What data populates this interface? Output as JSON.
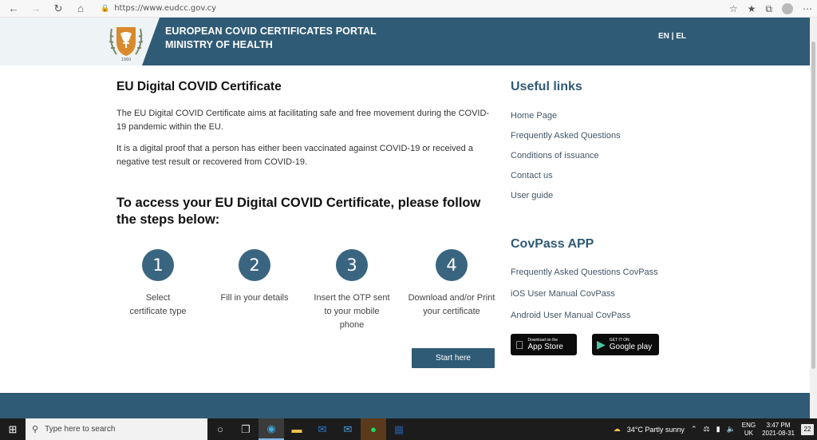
{
  "browser": {
    "url": "https://www.eudcc.gov.cy",
    "back_icon": "arrow-left-icon",
    "forward_icon": "arrow-right-icon",
    "reload_icon": "reload-icon",
    "home_icon": "home-icon"
  },
  "header": {
    "title_line1": "EUROPEAN COVID CERTIFICATES PORTAL",
    "title_line2": "MINISTRY OF HEALTH",
    "lang_en": "EN",
    "lang_sep": "|",
    "lang_el": "EL"
  },
  "main": {
    "title": "EU Digital COVID Certificate",
    "para1": "The EU Digital COVID Certificate aims at facilitating safe and free movement during the COVID-19 pandemic within the EU.",
    "para2": "It is a digital proof that a person has either been vaccinated against COVID-19 or received a negative test result or recovered from COVID-19.",
    "steps_title": "To access your EU Digital COVID Certificate, please follow the steps below:",
    "steps": [
      {
        "number": "1",
        "label": "Select certificate type"
      },
      {
        "number": "2",
        "label": "Fill in your details"
      },
      {
        "number": "3",
        "label": "Insert the OTP sent to your mobile phone"
      },
      {
        "number": "4",
        "label": "Download and/or Print your certificate"
      }
    ],
    "start_button": "Start here"
  },
  "sidebar": {
    "useful_links_title": "Useful links",
    "links": [
      "Home Page",
      "Frequently Asked Questions",
      "Conditions of issuance",
      "Contact us",
      "User guide"
    ],
    "covpass_title": "CovPass APP",
    "covpass_links": [
      "Frequently Asked Questions CovPass",
      "iOS User Manual CovPass",
      "Android User Manual CovPass"
    ],
    "app_store": {
      "small": "Download on the",
      "big": "App Store"
    },
    "google_play": {
      "small": "GET IT ON",
      "big": "Google play"
    }
  },
  "taskbar": {
    "search_placeholder": "Type here to search",
    "weather": "34°C  Partly sunny",
    "lang_top": "ENG",
    "lang_bottom": "UK",
    "time": "3:47 PM",
    "date": "2021-08-31",
    "notifications": "22"
  },
  "colors": {
    "brand": "#2f5b76",
    "step_circle": "#3a6580",
    "header_bg": "#eef3f6"
  }
}
